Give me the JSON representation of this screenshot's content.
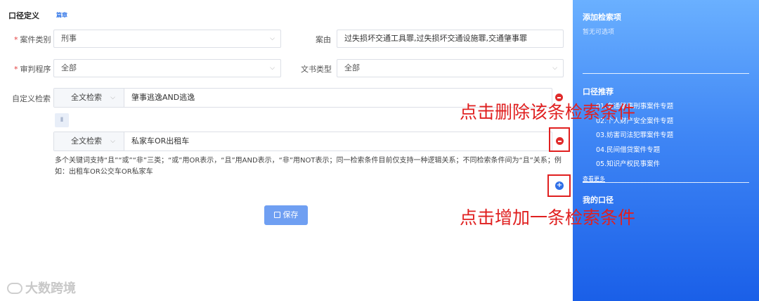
{
  "header": {
    "title": "口径定义",
    "tag": "篇章"
  },
  "form": {
    "case_type": {
      "label": "案件类别",
      "required_mark": "*",
      "value": "刑事"
    },
    "cause": {
      "label": "案由",
      "value": "过失损坏交通工具罪,过失损坏交通设施罪,交通肇事罪"
    },
    "procedure": {
      "label": "审判程序",
      "required_mark": "*",
      "value": "全部"
    },
    "doc_type": {
      "label": "文书类型",
      "value": "全部"
    },
    "custom_search": {
      "label": "自定义检索",
      "conditions": [
        {
          "type": "全文检索",
          "text": "肇事逃逸AND逃逸"
        },
        {
          "type": "全文检索",
          "text": "私家车OR出租车"
        }
      ],
      "connector": "且"
    },
    "chevron": "⌵",
    "hint": "多个关键词支持“且”“或”“非”三类；“或”用OR表示，“且”用AND表示，“非”用NOT表示；同一检索条件目前仅支持一种逻辑关系；不同检索条件间为“且”关系；例如：出租车OR公交车OR私家车",
    "save_label": "保存"
  },
  "annotations": {
    "delete_text": "点击删除该条检索条件",
    "add_text": "点击增加一条检索条件",
    "color": "#e02020"
  },
  "watermark": "大数跨境",
  "sidebar": {
    "add_title": "添加检索项",
    "add_empty": "暂无可选项",
    "recommend_title": "口径推荐",
    "items": [
      "01.交通肇事刑事案件专题",
      "02.个人财产安全案件专题",
      "03.妨害司法犯罪案件专题",
      "04.民间借贷案件专题",
      "05.知识产权民事案件"
    ],
    "more": "查看更多",
    "mine_title": "我的口径"
  },
  "colors": {
    "accent": "#3f86f5",
    "danger": "#e02b2b",
    "save_button": "#6f9ff2"
  }
}
